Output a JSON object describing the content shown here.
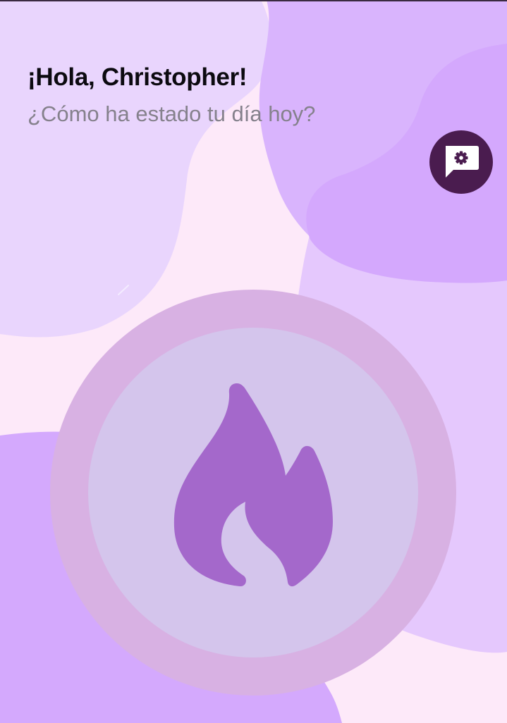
{
  "header": {
    "greeting": "¡Hola, Christopher!",
    "subtitle": "¿Cómo ha estado tu día hoy?"
  },
  "settings_button": {
    "icon": "chat-settings-icon",
    "background": "#4a1c4f"
  },
  "streak": {
    "icon": "flame-icon",
    "ring_color": "#d8b1e3",
    "inner_color": "#d4c5ec",
    "icon_color": "#a468cb"
  },
  "colors": {
    "background": "#fde9f9",
    "blob_light": "#e9d4fd",
    "blob_mid": "#d9b5fd",
    "blob_dark": "#d3a8fd"
  }
}
